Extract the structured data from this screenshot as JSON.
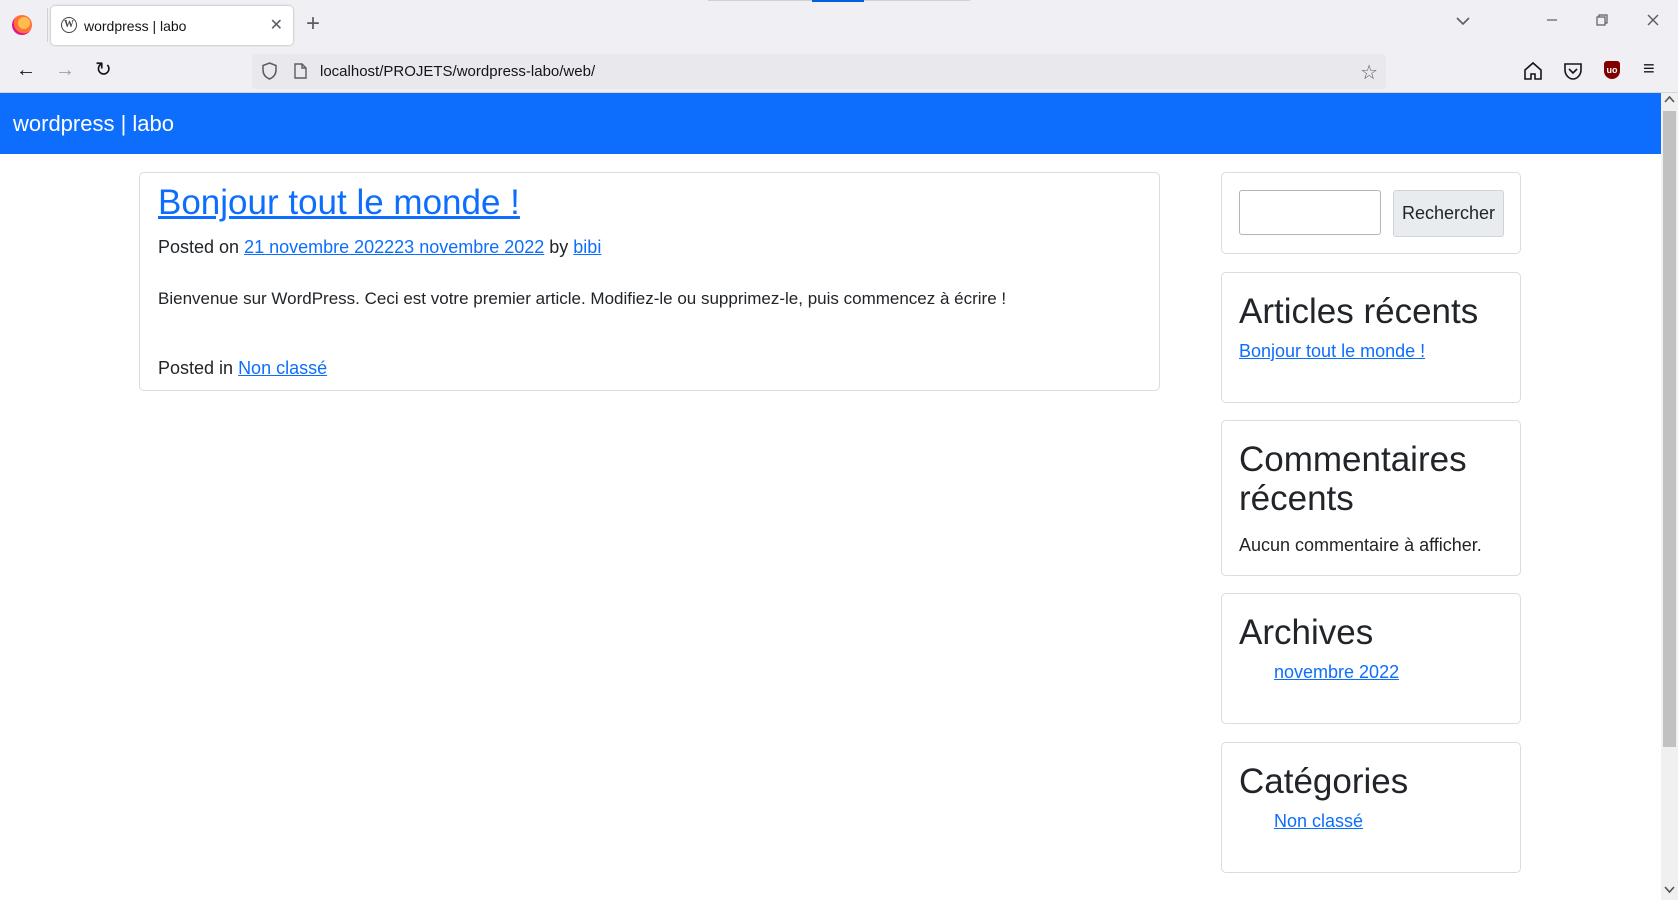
{
  "browser": {
    "tab_title": "wordpress | labo",
    "tab_close": "✕",
    "new_tab": "+",
    "list_all_tabs": "⌄",
    "window_minimize": "—",
    "window_restore": "⧉",
    "window_close": "✕",
    "url": "localhost/PROJETS/wordpress-labo/web/",
    "back": "←",
    "forward": "→",
    "reload": "↻",
    "bookmark_star": "☆",
    "menu": "≡",
    "ublock_label": "uo"
  },
  "site": {
    "title": "wordpress | labo"
  },
  "post": {
    "title": "Bonjour tout le monde !",
    "meta_prefix": "Posted on ",
    "date_link": "21 novembre 202223 novembre 2022",
    "by": " by ",
    "author": "bibi",
    "body": "Bienvenue sur WordPress. Ceci est votre premier article. Modifiez-le ou supprimez-le, puis commencez à écrire !",
    "footer_prefix": "Posted in ",
    "category": "Non classé"
  },
  "sidebar": {
    "search_button": "Rechercher",
    "recent_posts_title": "Articles récents",
    "recent_posts": [
      "Bonjour tout le monde !"
    ],
    "recent_comments_title_line1": "Commentaires",
    "recent_comments_title_line2": "récents",
    "recent_comments_empty": "Aucun commentaire à afficher.",
    "archives_title": "Archives",
    "archives": [
      "novembre 2022"
    ],
    "categories_title": "Catégories",
    "categories": [
      "Non classé"
    ]
  },
  "colors": {
    "header_bg": "#0d6efd",
    "link": "#0d6efd"
  }
}
